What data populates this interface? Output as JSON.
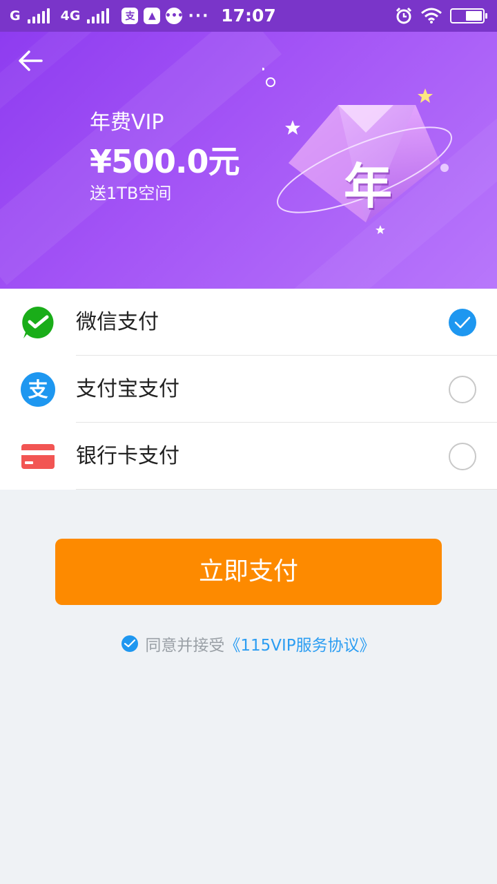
{
  "status_bar": {
    "carrier1": "G",
    "carrier2": "4G",
    "time": "17:07",
    "battery_level": 0.55
  },
  "hero": {
    "plan_name": "年费VIP",
    "price": "¥500.0元",
    "bonus": "送1TB空间",
    "badge_char": "年"
  },
  "payment_methods": [
    {
      "label": "微信支付",
      "icon": "wechat-pay-icon",
      "selected": true
    },
    {
      "label": "支付宝支付",
      "icon": "alipay-icon",
      "selected": false
    },
    {
      "label": "银行卡支付",
      "icon": "bank-card-icon",
      "selected": false
    }
  ],
  "pay_button": "立即支付",
  "agreement": {
    "agreed": true,
    "text": "同意并接受",
    "link": "《115VIP服务协议》"
  },
  "colors": {
    "hero_purple": "#9b4cf4",
    "wechat_green": "#1aad19",
    "alipay_blue": "#1e97f0",
    "bank_red": "#f25553",
    "pay_orange": "#fd8a00",
    "link_blue": "#2b9df2"
  }
}
